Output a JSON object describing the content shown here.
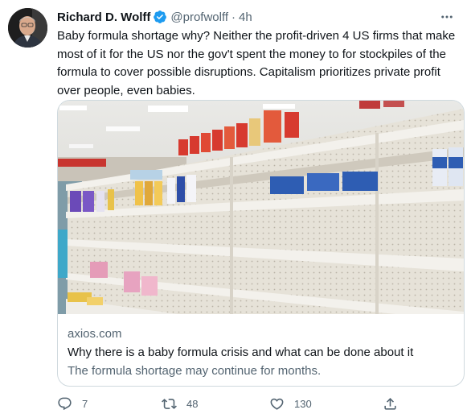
{
  "tweet": {
    "author": {
      "name": "Richard D. Wolff",
      "handle": "@profwolff",
      "separator": "·",
      "time": "4h",
      "verified": true
    },
    "text": "Baby formula shortage why? Neither the profit-driven 4 US firms that make most of it for the US nor the gov't spent the money to for stockpiles of the formula to cover possible disruptions. Capitalism prioritizes private profit over people, even babies.",
    "more_icon": "more-horizontal-icon",
    "card": {
      "domain": "axios.com",
      "title": "Why there is a baby formula crisis and what can be done about it",
      "description": "The formula shortage may continue for months."
    },
    "actions": {
      "reply": {
        "icon": "reply-icon",
        "count": "7"
      },
      "retweet": {
        "icon": "retweet-icon",
        "count": "48"
      },
      "like": {
        "icon": "heart-icon",
        "count": "130"
      },
      "share": {
        "icon": "share-icon"
      }
    }
  },
  "colors": {
    "text_primary": "#0f1419",
    "text_secondary": "#536471",
    "verified_blue": "#1d9bf0",
    "border": "#cfd9de"
  }
}
